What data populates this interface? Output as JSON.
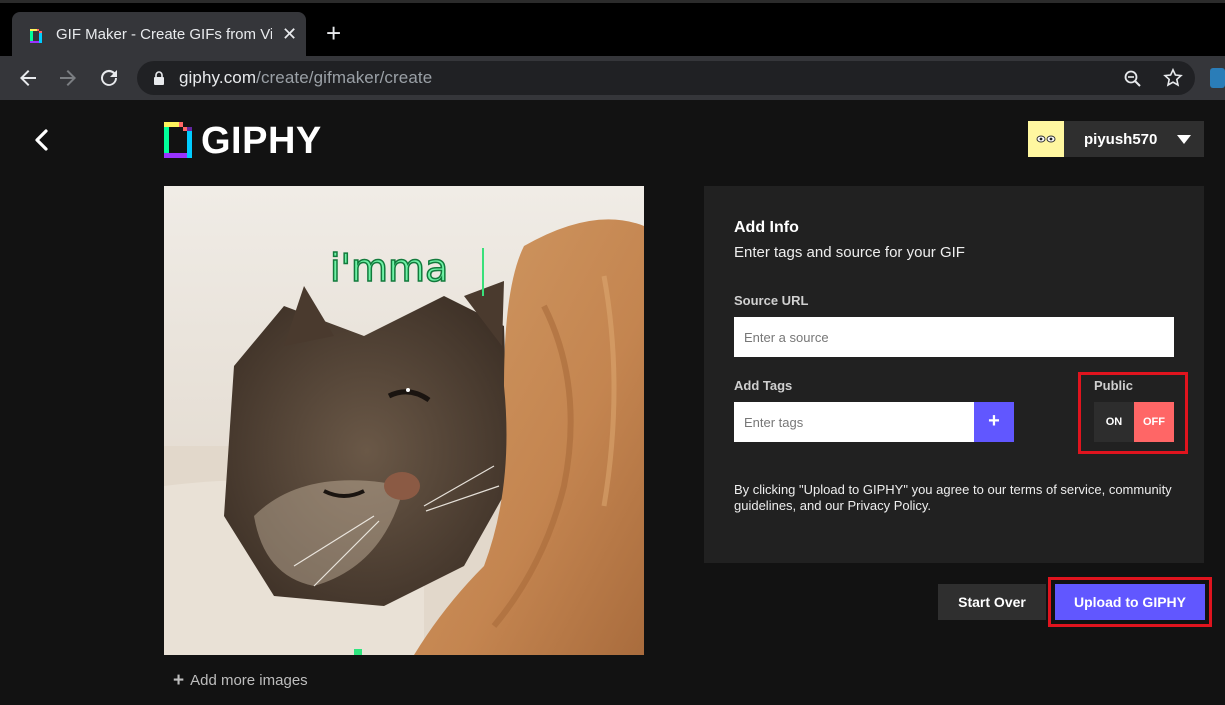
{
  "browser": {
    "tab_title": "GIF Maker - Create GIFs from Vid",
    "tab_close": "✕",
    "new_tab": "+",
    "url_host": "giphy.com",
    "url_path": "/create/gifmaker/create"
  },
  "header": {
    "logo_text": "GIPHY",
    "username": "piyush570"
  },
  "preview": {
    "caption_text": "i'mma"
  },
  "add_more_label": "Add more images",
  "add_more_plus": "+",
  "info": {
    "title": "Add Info",
    "subtitle": "Enter tags and source for your GIF",
    "source_label": "Source URL",
    "source_placeholder": "Enter a source",
    "tags_label": "Add Tags",
    "tags_placeholder": "Enter tags",
    "tags_add": "+",
    "public_label": "Public",
    "toggle_on": "ON",
    "toggle_off": "OFF",
    "terms": "By clicking \"Upload to GIPHY\" you agree to our terms of service, community guidelines, and our Privacy Policy."
  },
  "actions": {
    "start_over": "Start Over",
    "upload": "Upload to GIPHY"
  },
  "colors": {
    "accent": "#6157ff",
    "toggle_off": "#ff6666",
    "highlight": "#e0141e"
  }
}
